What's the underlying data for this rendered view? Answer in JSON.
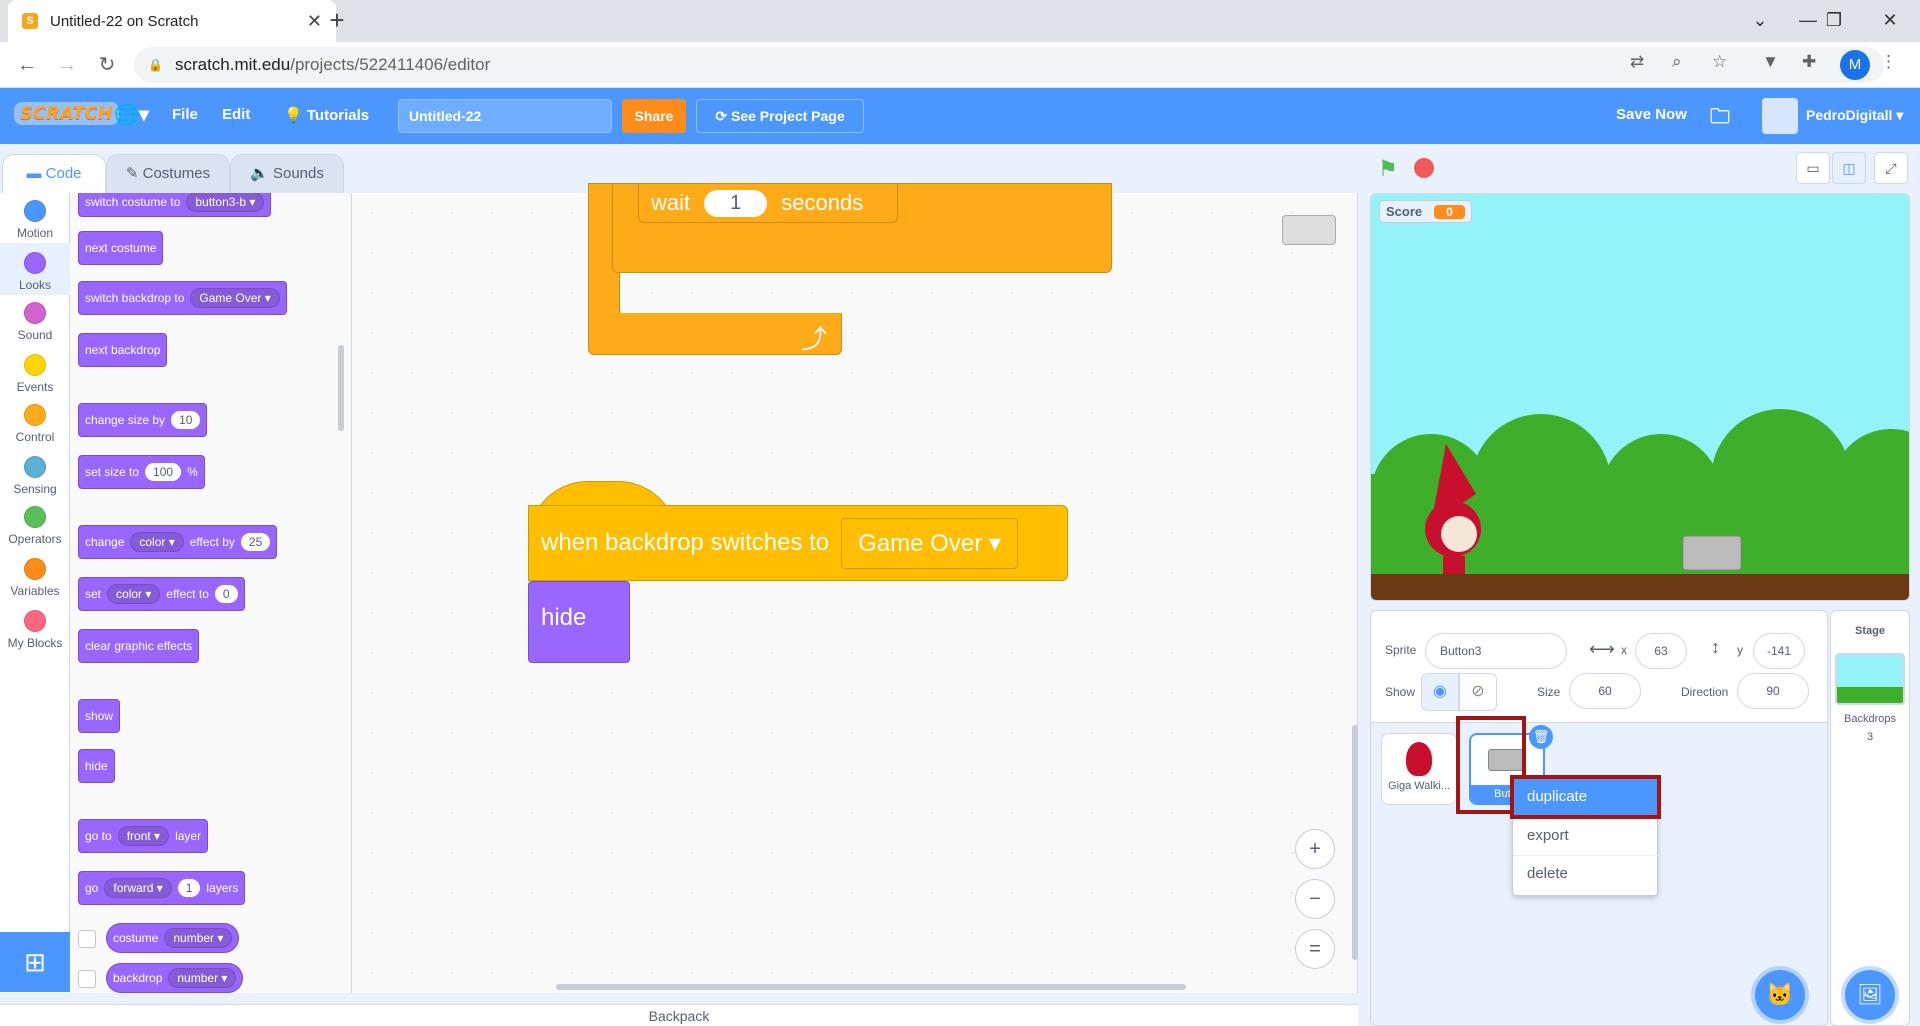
{
  "browser": {
    "tab_title": "Untitled-22 on Scratch",
    "tab_close": "✕",
    "new_tab": "+",
    "url_host": "scratch.mit.edu",
    "url_path": "/projects/522411406/editor",
    "profile_initial": "M"
  },
  "menubar": {
    "logo": "SCRATCH",
    "file": "File",
    "edit": "Edit",
    "tutorials": "Tutorials",
    "project_title": "Untitled-22",
    "share": "Share",
    "see_project_page": "See Project Page",
    "save_now": "Save Now",
    "username": "PedroDigitall"
  },
  "editor_tabs": {
    "code": "Code",
    "costumes": "Costumes",
    "sounds": "Sounds"
  },
  "categories": [
    {
      "label": "Motion",
      "color": "#4c97ff"
    },
    {
      "label": "Looks",
      "color": "#9966ff"
    },
    {
      "label": "Sound",
      "color": "#cf63cf"
    },
    {
      "label": "Events",
      "color": "#ffd500"
    },
    {
      "label": "Control",
      "color": "#ffab19"
    },
    {
      "label": "Sensing",
      "color": "#5cb1d6"
    },
    {
      "label": "Operators",
      "color": "#59c059"
    },
    {
      "label": "Variables",
      "color": "#ff8c1a"
    },
    {
      "label": "My Blocks",
      "color": "#ff6680"
    }
  ],
  "palette": {
    "switch_costume": "switch costume to",
    "switch_costume_val": "button3-b",
    "next_costume": "next costume",
    "switch_backdrop": "switch backdrop to",
    "switch_backdrop_val": "Game Over",
    "next_backdrop": "next backdrop",
    "change_size": "change size by",
    "change_size_val": "10",
    "set_size": "set size to",
    "set_size_val": "100",
    "set_size_unit": "%",
    "change_effect": "change",
    "change_effect_dd": "color",
    "change_effect_by": "effect by",
    "change_effect_val": "25",
    "set_effect": "set",
    "set_effect_dd": "color",
    "set_effect_to": "effect to",
    "set_effect_val": "0",
    "clear_effects": "clear graphic effects",
    "show": "show",
    "hide": "hide",
    "go_to": "go to",
    "go_to_dd": "front",
    "go_to_layer": "layer",
    "go": "go",
    "go_dd": "forward",
    "go_val": "1",
    "go_layers": "layers",
    "costume": "costume",
    "costume_dd": "number",
    "backdrop": "backdrop",
    "backdrop_dd": "number"
  },
  "workspace": {
    "wait_label": "wait",
    "wait_val": "1",
    "seconds_label": "seconds",
    "loop_arrow": "⤴",
    "hat_label": "when backdrop switches to",
    "hat_value": "Game Over",
    "hide_block": "hide",
    "zoom_in": "+",
    "zoom_out": "−",
    "zoom_reset": "="
  },
  "backpack": "Backpack",
  "stage": {
    "score_label": "Score",
    "score_value": "0"
  },
  "sprite_info": {
    "sprite_label": "Sprite",
    "sprite_name": "Button3",
    "x_label": "x",
    "x_val": "63",
    "y_label": "y",
    "y_val": "-141",
    "show_label": "Show",
    "size_label": "Size",
    "size_val": "60",
    "direction_label": "Direction",
    "direction_val": "90"
  },
  "sprites": [
    {
      "name": "Giga Walki..."
    },
    {
      "name": "Butto"
    }
  ],
  "context_menu": {
    "duplicate": "duplicate",
    "export": "export",
    "delete": "delete"
  },
  "stage_pane": {
    "title": "Stage",
    "backdrops_label": "Backdrops",
    "backdrops_count": "3"
  }
}
